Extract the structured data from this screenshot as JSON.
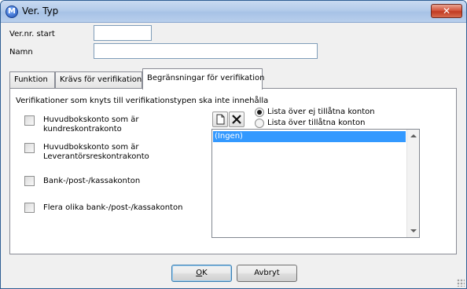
{
  "window": {
    "title": "Ver. Typ",
    "app_icon_glyph": "M",
    "close_glyph": "✕"
  },
  "form": {
    "vernr_label": "Ver.nr. start",
    "vernr_value": "",
    "namn_label": "Namn",
    "namn_value": ""
  },
  "tabs": [
    {
      "label": "Funktion",
      "active": false
    },
    {
      "label": "Krävs för verifikation",
      "active": false
    },
    {
      "label": "Begränsningar för verifikation",
      "active": true
    }
  ],
  "panel": {
    "heading": "Verifikationer som knyts till verifikationstypen ska inte innehålla",
    "checkboxes": [
      {
        "label": "Huvudbokskonto som är\nkundreskontrakonto",
        "checked": false
      },
      {
        "label": "Huvudbokskonto som är\nLeverantörsreskontrakonto",
        "checked": false
      },
      {
        "label": "Bank-/post-/kassakonton",
        "checked": false
      },
      {
        "label": "Flera olika bank-/post-/kassakonton",
        "checked": false
      }
    ],
    "radios": [
      {
        "label": "Lista över ej tillåtna konton",
        "selected": true
      },
      {
        "label": "Lista över tillåtna konton",
        "selected": false
      }
    ],
    "toolbar": {
      "new_icon": "new-document-icon",
      "delete_icon": "delete-x-icon"
    },
    "list_items": [
      "(Ingen)"
    ]
  },
  "buttons": {
    "ok": "OK",
    "cancel": "Avbryt"
  },
  "colors": {
    "selection": "#3399ff",
    "titlebar": "#b8cfec",
    "close": "#c13b22"
  }
}
